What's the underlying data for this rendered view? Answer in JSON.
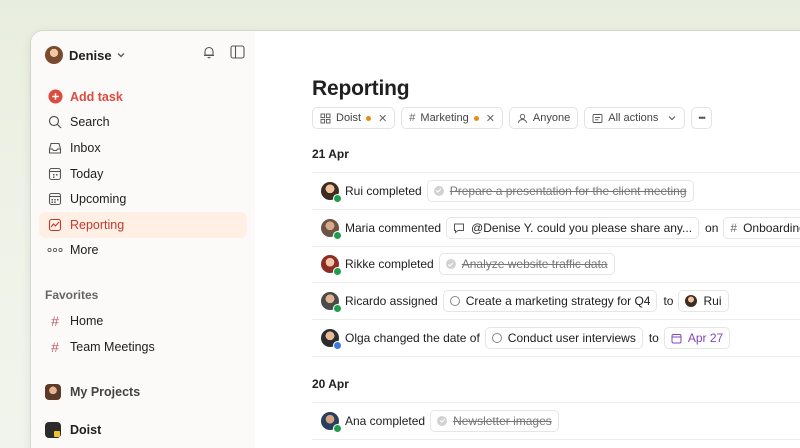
{
  "sidebar": {
    "user": {
      "name": "Denise"
    },
    "nav": [
      {
        "id": "add",
        "label": "Add task",
        "icon": "plus-circle-icon"
      },
      {
        "id": "search",
        "label": "Search",
        "icon": "search-icon"
      },
      {
        "id": "inbox",
        "label": "Inbox",
        "icon": "inbox-icon"
      },
      {
        "id": "today",
        "label": "Today",
        "icon": "calendar-today-icon"
      },
      {
        "id": "upcoming",
        "label": "Upcoming",
        "icon": "calendar-upcoming-icon"
      },
      {
        "id": "reporting",
        "label": "Reporting",
        "icon": "chart-icon",
        "active": true
      },
      {
        "id": "more",
        "label": "More",
        "icon": "more-icon"
      }
    ],
    "favorites_title": "Favorites",
    "favorites": [
      {
        "label": "Home"
      },
      {
        "label": "Team Meetings"
      }
    ],
    "projects": [
      {
        "label": "My Projects"
      },
      {
        "label": "Doist"
      }
    ]
  },
  "main": {
    "title": "Reporting",
    "filters": {
      "doist": "Doist",
      "marketing": "Marketing",
      "anyone": "Anyone",
      "all_actions": "All actions",
      "more": "•••"
    },
    "sections": [
      {
        "date": "21 Apr",
        "rows": [
          {
            "actor": "Rui completed",
            "task": "Prepare a presentation for the client meeting"
          },
          {
            "actor": "Maria commented",
            "comment": "@Denise Y. could you please share any...",
            "on": "on",
            "project": "Onboarding"
          },
          {
            "actor": "Rikke completed",
            "task": "Analyze website traffic data"
          },
          {
            "actor": "Ricardo assigned",
            "task": "Create a marketing strategy for Q4",
            "to": "to",
            "person": "Rui"
          },
          {
            "actor": "Olga changed the date of",
            "task": "Conduct user interviews",
            "to": "to",
            "date": "Apr 27"
          }
        ]
      },
      {
        "date": "20 Apr",
        "rows": [
          {
            "actor": "Ana completed",
            "task": "Newsletter images"
          }
        ]
      }
    ]
  },
  "colors": {
    "accent": "#dc4c3e",
    "active_bg": "#ffefe5",
    "favorite_hash": "#c06070",
    "badge_green": "#1f9d4d",
    "badge_blue": "#3b7be0",
    "date_purple": "#8743b6",
    "filter_dot": "#e98a1d"
  }
}
